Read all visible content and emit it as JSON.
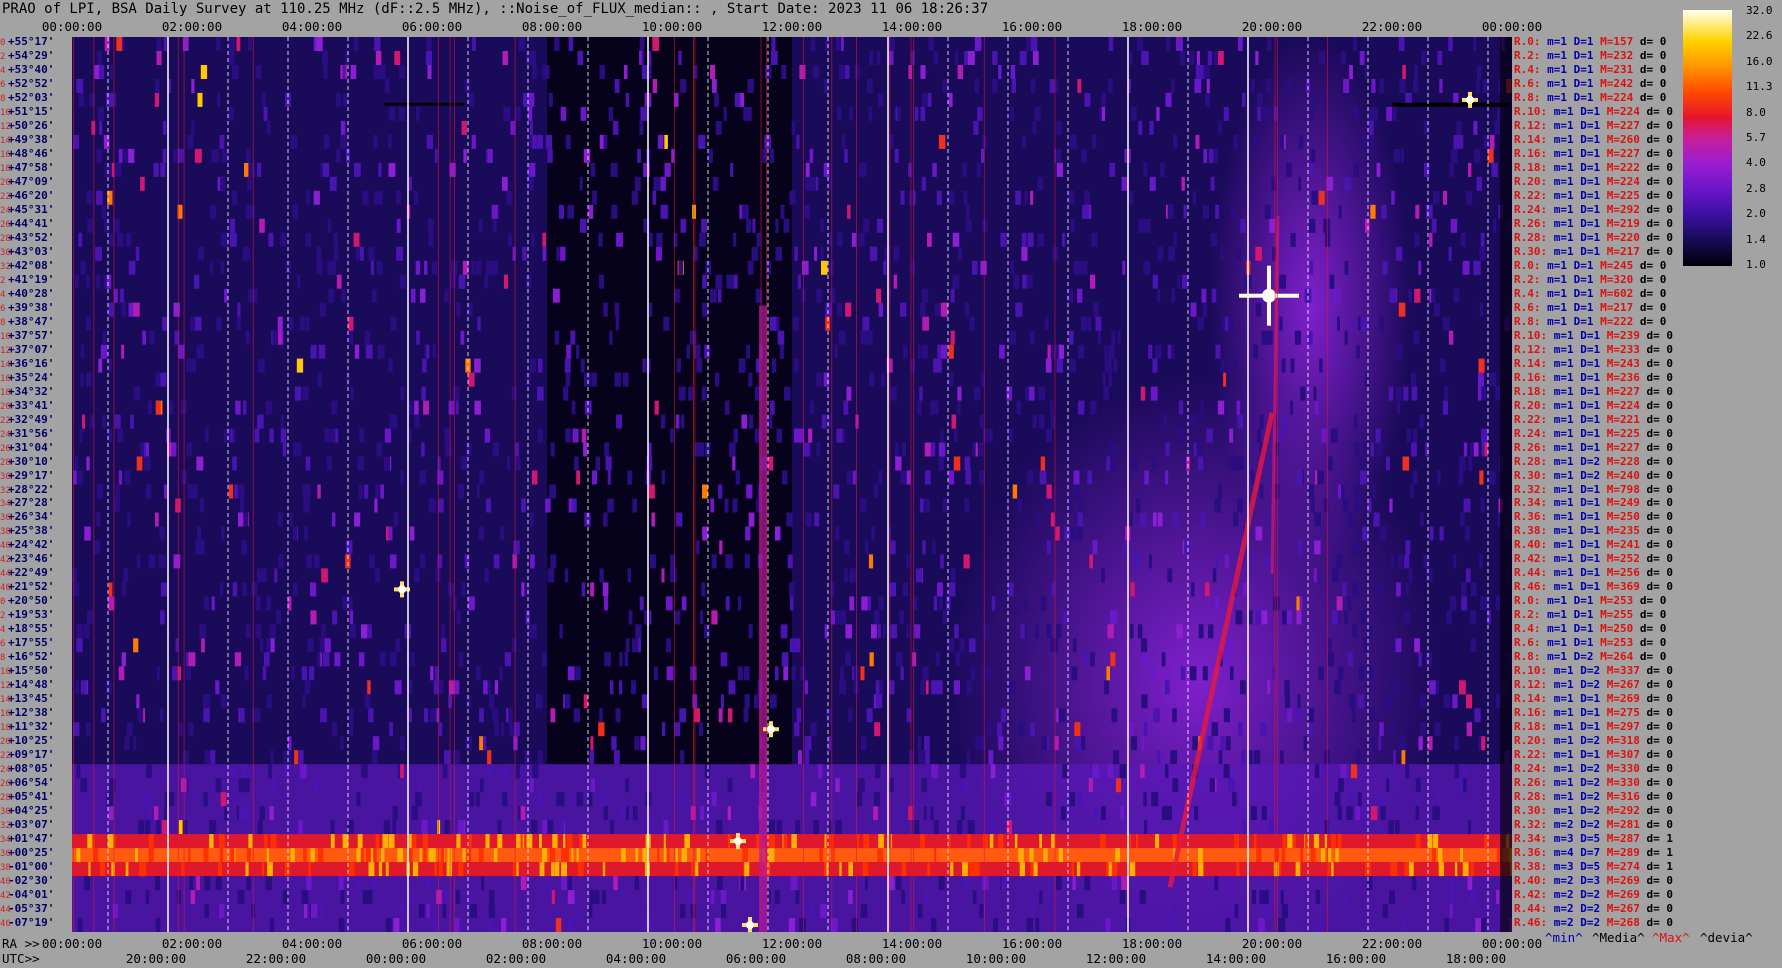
{
  "title": "PRAO of LPI, BSA Daily Survey at 110.25 MHz (dF::2.5 MHz), ::Noise_of_FLUX_median:: , Start Date: 2023 11 06 18:26:37",
  "top_axis_ticks": [
    "00:00:00",
    "02:00:00",
    "04:00:00",
    "06:00:00",
    "08:00:00",
    "10:00:00",
    "12:00:00",
    "14:00:00",
    "16:00:00",
    "18:00:00",
    "20:00:00",
    "22:00:00",
    "00:00:00"
  ],
  "ra_label": "RA >>",
  "ra_ticks": [
    "00:00:00",
    "02:00:00",
    "04:00:00",
    "06:00:00",
    "08:00:00",
    "10:00:00",
    "12:00:00",
    "14:00:00",
    "16:00:00",
    "18:00:00",
    "20:00:00",
    "22:00:00",
    "00:00:00"
  ],
  "utc_label": "UTC>>",
  "utc_ticks": [
    "20:00:00",
    "22:00:00",
    "00:00:00",
    "02:00:00",
    "04:00:00",
    "06:00:00",
    "08:00:00",
    "10:00:00",
    "12:00:00",
    "14:00:00",
    "16:00:00",
    "18:00:00"
  ],
  "colorbar": {
    "labels": [
      "32.0",
      "22.6",
      "16.0",
      "11.3",
      "8.0",
      "5.7",
      "4.0",
      "2.8",
      "2.0",
      "1.4",
      "1.0"
    ],
    "colors": [
      "#000008",
      "#3c10a0",
      "#9a1ed0",
      "#e6142e",
      "#ff9500",
      "#ffd200",
      "#fffff0"
    ]
  },
  "declination_labels": [
    {
      "n": "0",
      "v": "+55°17'"
    },
    {
      "n": "2",
      "v": "+54°29'"
    },
    {
      "n": "4",
      "v": "+53°40'"
    },
    {
      "n": "6",
      "v": "+52°52'"
    },
    {
      "n": "8",
      "v": "+52°03'"
    },
    {
      "n": "10",
      "v": "+51°15'"
    },
    {
      "n": "12",
      "v": "+50°26'"
    },
    {
      "n": "14",
      "v": "+49°38'"
    },
    {
      "n": "16",
      "v": "+48°46'"
    },
    {
      "n": "18",
      "v": "+47°58'"
    },
    {
      "n": "20",
      "v": "+47°09'"
    },
    {
      "n": "22",
      "v": "+46°20'"
    },
    {
      "n": "24",
      "v": "+45°31'"
    },
    {
      "n": "26",
      "v": "+44°41'"
    },
    {
      "n": "28",
      "v": "+43°52'"
    },
    {
      "n": "30",
      "v": "+43°03'"
    },
    {
      "n": "32",
      "v": "+42°08'"
    },
    {
      "n": "2",
      "v": "+41°19'"
    },
    {
      "n": "4",
      "v": "+40°28'"
    },
    {
      "n": "6",
      "v": "+39°38'"
    },
    {
      "n": "8",
      "v": "+38°47'"
    },
    {
      "n": "10",
      "v": "+37°57'"
    },
    {
      "n": "12",
      "v": "+37°07'"
    },
    {
      "n": "14",
      "v": "+36°16'"
    },
    {
      "n": "16",
      "v": "+35°24'"
    },
    {
      "n": "18",
      "v": "+34°32'"
    },
    {
      "n": "20",
      "v": "+33°41'"
    },
    {
      "n": "22",
      "v": "+32°49'"
    },
    {
      "n": "24",
      "v": "+31°56'"
    },
    {
      "n": "26",
      "v": "+31°04'"
    },
    {
      "n": "28",
      "v": "+30°10'"
    },
    {
      "n": "30",
      "v": "+29°17'"
    },
    {
      "n": "32",
      "v": "+28°22'"
    },
    {
      "n": "34",
      "v": "+27°28'"
    },
    {
      "n": "36",
      "v": "+26°34'"
    },
    {
      "n": "38",
      "v": "+25°38'"
    },
    {
      "n": "40",
      "v": "+24°42'"
    },
    {
      "n": "42",
      "v": "+23°46'"
    },
    {
      "n": "44",
      "v": "+22°49'"
    },
    {
      "n": "46",
      "v": "+21°52'"
    },
    {
      "n": "0",
      "v": "+20°50'"
    },
    {
      "n": "2",
      "v": "+19°53'"
    },
    {
      "n": "4",
      "v": "+18°55'"
    },
    {
      "n": "6",
      "v": "+17°55'"
    },
    {
      "n": "8",
      "v": "+16°52'"
    },
    {
      "n": "10",
      "v": "+15°50'"
    },
    {
      "n": "12",
      "v": "+14°48'"
    },
    {
      "n": "14",
      "v": "+13°45'"
    },
    {
      "n": "16",
      "v": "+12°38'"
    },
    {
      "n": "18",
      "v": "+11°32'"
    },
    {
      "n": "20",
      "v": "+10°25'"
    },
    {
      "n": "22",
      "v": "+09°17'"
    },
    {
      "n": "24",
      "v": "+08°05'"
    },
    {
      "n": "26",
      "v": "+06°54'"
    },
    {
      "n": "28",
      "v": "+05°41'"
    },
    {
      "n": "30",
      "v": "+04°25'"
    },
    {
      "n": "32",
      "v": "+03°07'"
    },
    {
      "n": "34",
      "v": "+01°47'"
    },
    {
      "n": "36",
      "v": "+00°25'"
    },
    {
      "n": "38",
      "v": "-01°00'"
    },
    {
      "n": "40",
      "v": "-02°30'"
    },
    {
      "n": "42",
      "v": "-04°01'"
    },
    {
      "n": "44",
      "v": "-05°37'"
    },
    {
      "n": "46",
      "v": "-07°19'"
    }
  ],
  "receiver_stats": [
    {
      "r": "R.0:",
      "m": "1",
      "D": "1",
      "M": "157",
      "d": "0"
    },
    {
      "r": "R.2:",
      "m": "1",
      "D": "1",
      "M": "232",
      "d": "0"
    },
    {
      "r": "R.4:",
      "m": "1",
      "D": "1",
      "M": "231",
      "d": "0"
    },
    {
      "r": "R.6:",
      "m": "1",
      "D": "1",
      "M": "242",
      "d": "0"
    },
    {
      "r": "R.8:",
      "m": "1",
      "D": "1",
      "M": "224",
      "d": "0"
    },
    {
      "r": "R.10:",
      "m": "1",
      "D": "1",
      "M": "224",
      "d": "0"
    },
    {
      "r": "R.12:",
      "m": "1",
      "D": "1",
      "M": "227",
      "d": "0"
    },
    {
      "r": "R.14:",
      "m": "1",
      "D": "1",
      "M": "260",
      "d": "0"
    },
    {
      "r": "R.16:",
      "m": "1",
      "D": "1",
      "M": "227",
      "d": "0"
    },
    {
      "r": "R.18:",
      "m": "1",
      "D": "1",
      "M": "222",
      "d": "0"
    },
    {
      "r": "R.20:",
      "m": "1",
      "D": "1",
      "M": "224",
      "d": "0"
    },
    {
      "r": "R.22:",
      "m": "1",
      "D": "1",
      "M": "225",
      "d": "0"
    },
    {
      "r": "R.24:",
      "m": "1",
      "D": "1",
      "M": "292",
      "d": "0"
    },
    {
      "r": "R.26:",
      "m": "1",
      "D": "1",
      "M": "219",
      "d": "0"
    },
    {
      "r": "R.28:",
      "m": "1",
      "D": "1",
      "M": "220",
      "d": "0"
    },
    {
      "r": "R.30:",
      "m": "1",
      "D": "1",
      "M": "217",
      "d": "0"
    },
    {
      "r": "R.0:",
      "m": "1",
      "D": "1",
      "M": "245",
      "d": "0"
    },
    {
      "r": "R.2:",
      "m": "1",
      "D": "1",
      "M": "320",
      "d": "0"
    },
    {
      "r": "R.4:",
      "m": "1",
      "D": "1",
      "M": "602",
      "d": "0"
    },
    {
      "r": "R.6:",
      "m": "1",
      "D": "1",
      "M": "217",
      "d": "0"
    },
    {
      "r": "R.8:",
      "m": "1",
      "D": "1",
      "M": "222",
      "d": "0"
    },
    {
      "r": "R.10:",
      "m": "1",
      "D": "1",
      "M": "239",
      "d": "0"
    },
    {
      "r": "R.12:",
      "m": "1",
      "D": "1",
      "M": "233",
      "d": "0"
    },
    {
      "r": "R.14:",
      "m": "1",
      "D": "1",
      "M": "243",
      "d": "0"
    },
    {
      "r": "R.16:",
      "m": "1",
      "D": "1",
      "M": "236",
      "d": "0"
    },
    {
      "r": "R.18:",
      "m": "1",
      "D": "1",
      "M": "227",
      "d": "0"
    },
    {
      "r": "R.20:",
      "m": "1",
      "D": "1",
      "M": "224",
      "d": "0"
    },
    {
      "r": "R.22:",
      "m": "1",
      "D": "1",
      "M": "221",
      "d": "0"
    },
    {
      "r": "R.24:",
      "m": "1",
      "D": "1",
      "M": "225",
      "d": "0"
    },
    {
      "r": "R.26:",
      "m": "1",
      "D": "1",
      "M": "227",
      "d": "0"
    },
    {
      "r": "R.28:",
      "m": "1",
      "D": "2",
      "M": "228",
      "d": "0"
    },
    {
      "r": "R.30:",
      "m": "1",
      "D": "2",
      "M": "240",
      "d": "0"
    },
    {
      "r": "R.32:",
      "m": "1",
      "D": "1",
      "M": "798",
      "d": "0"
    },
    {
      "r": "R.34:",
      "m": "1",
      "D": "1",
      "M": "249",
      "d": "0"
    },
    {
      "r": "R.36:",
      "m": "1",
      "D": "1",
      "M": "250",
      "d": "0"
    },
    {
      "r": "R.38:",
      "m": "1",
      "D": "1",
      "M": "235",
      "d": "0"
    },
    {
      "r": "R.40:",
      "m": "1",
      "D": "1",
      "M": "241",
      "d": "0"
    },
    {
      "r": "R.42:",
      "m": "1",
      "D": "1",
      "M": "252",
      "d": "0"
    },
    {
      "r": "R.44:",
      "m": "1",
      "D": "1",
      "M": "256",
      "d": "0"
    },
    {
      "r": "R.46:",
      "m": "1",
      "D": "1",
      "M": "369",
      "d": "0"
    },
    {
      "r": "R.0:",
      "m": "1",
      "D": "1",
      "M": "253",
      "d": "0"
    },
    {
      "r": "R.2:",
      "m": "1",
      "D": "1",
      "M": "255",
      "d": "0"
    },
    {
      "r": "R.4:",
      "m": "1",
      "D": "1",
      "M": "250",
      "d": "0"
    },
    {
      "r": "R.6:",
      "m": "1",
      "D": "1",
      "M": "253",
      "d": "0"
    },
    {
      "r": "R.8:",
      "m": "1",
      "D": "2",
      "M": "264",
      "d": "0"
    },
    {
      "r": "R.10:",
      "m": "1",
      "D": "2",
      "M": "337",
      "d": "0"
    },
    {
      "r": "R.12:",
      "m": "1",
      "D": "2",
      "M": "267",
      "d": "0"
    },
    {
      "r": "R.14:",
      "m": "1",
      "D": "1",
      "M": "269",
      "d": "0"
    },
    {
      "r": "R.16:",
      "m": "1",
      "D": "1",
      "M": "275",
      "d": "0"
    },
    {
      "r": "R.18:",
      "m": "1",
      "D": "1",
      "M": "297",
      "d": "0"
    },
    {
      "r": "R.20:",
      "m": "1",
      "D": "2",
      "M": "318",
      "d": "0"
    },
    {
      "r": "R.22:",
      "m": "1",
      "D": "1",
      "M": "307",
      "d": "0"
    },
    {
      "r": "R.24:",
      "m": "1",
      "D": "2",
      "M": "330",
      "d": "0"
    },
    {
      "r": "R.26:",
      "m": "1",
      "D": "2",
      "M": "330",
      "d": "0"
    },
    {
      "r": "R.28:",
      "m": "1",
      "D": "2",
      "M": "316",
      "d": "0"
    },
    {
      "r": "R.30:",
      "m": "1",
      "D": "2",
      "M": "292",
      "d": "0"
    },
    {
      "r": "R.32:",
      "m": "2",
      "D": "2",
      "M": "281",
      "d": "0"
    },
    {
      "r": "R.34:",
      "m": "3",
      "D": "5",
      "M": "287",
      "d": "1"
    },
    {
      "r": "R.36:",
      "m": "4",
      "D": "7",
      "M": "289",
      "d": "1"
    },
    {
      "r": "R.38:",
      "m": "3",
      "D": "5",
      "M": "274",
      "d": "1"
    },
    {
      "r": "R.40:",
      "m": "2",
      "D": "3",
      "M": "269",
      "d": "0"
    },
    {
      "r": "R.42:",
      "m": "2",
      "D": "2",
      "M": "269",
      "d": "0"
    },
    {
      "r": "R.44:",
      "m": "2",
      "D": "2",
      "M": "267",
      "d": "0"
    },
    {
      "r": "R.46:",
      "m": "2",
      "D": "2",
      "M": "268",
      "d": "0"
    }
  ],
  "legend": {
    "min": "^min^",
    "median": "^Media^",
    "max": "^Max^",
    "dev": "^devia^"
  },
  "chart_data": {
    "type": "heatmap",
    "title": "PRAO of LPI, BSA Daily Survey at 110.25 MHz (dF::2.5 MHz), ::Noise_of_FLUX_median:: , Start Date: 2023 11 06 18:26:37",
    "x_axis_ra_hours": [
      0,
      24
    ],
    "rows": 64,
    "color_scale": [
      1.0,
      32.0
    ],
    "solid_hour_lines": [
      1.6,
      5.6,
      9.6,
      13.6,
      17.6,
      19.6
    ],
    "bright_band_rows": [
      57,
      58,
      59
    ],
    "bright_sources": [
      {
        "ra_h": 19.95,
        "row": 18,
        "level": 32.0
      },
      {
        "ra_h": 23.3,
        "row": 4,
        "level": 16.0
      },
      {
        "ra_h": 11.65,
        "row": 49,
        "level": 11.3
      },
      {
        "ra_h": 5.5,
        "row": 39,
        "level": 11.3
      },
      {
        "ra_h": 11.1,
        "row": 57,
        "level": 16.0
      },
      {
        "ra_h": 11.3,
        "row": 63,
        "level": 16.0
      }
    ]
  }
}
